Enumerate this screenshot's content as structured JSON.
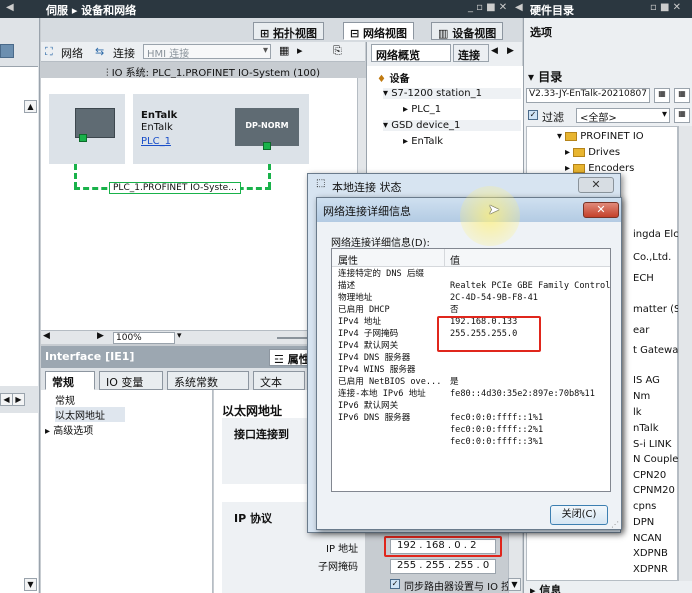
{
  "top_bar": {
    "left_title": "伺服 ▸ 设备和网络",
    "right_title": "硬件目录"
  },
  "view_tabs": {
    "topology": "拓扑视图",
    "network": "网络视图",
    "device": "设备视图"
  },
  "network_toolbar": {
    "network": "网络",
    "connection": "连接",
    "connection_type": "HMI 连接",
    "io_system": "IO 系统: PLC_1.PROFINET IO-System (100)"
  },
  "devices": {
    "plc_name": "EnTalk",
    "plc_type": "EnTalk",
    "plc_link": "PLC_1",
    "dp_norm": "DP-NORM",
    "network_label": "PLC_1.PROFINET IO-Syste..."
  },
  "overview": {
    "tab_overview": "网络概览",
    "tab_connection": "连接",
    "header": "设备",
    "items": [
      "S7-1200 station_1",
      "PLC_1",
      "GSD device_1",
      "EnTalk"
    ]
  },
  "zoom": "100%",
  "catalog": {
    "options_label": "选项",
    "directory_label": "目录",
    "search_value": "V2.33-JY-EnTalk-20210807",
    "filter_label": "过滤",
    "filter_value": "<全部>",
    "tree": [
      "PROFINET IO",
      "Drives",
      "Encoders"
    ],
    "partial_items": [
      "ingda Elc",
      "Co.,Ltd.",
      "ECH",
      "matter (S...",
      "ear",
      "t Gateway",
      "IS AG",
      "Nm",
      "lk",
      "nTalk",
      "S-i LINK",
      "N Coupler",
      "CPN20",
      "CPNM20",
      "cpns",
      "DPN",
      "NCAN",
      "XDPNB",
      "XDPNR"
    ],
    "info_label": "信息"
  },
  "interface": {
    "title": "Interface [IE1]",
    "properties": "属性",
    "tabs": [
      "常规",
      "IO 变量",
      "系统常数",
      "文本"
    ],
    "nav": [
      "常规",
      "以太网地址",
      "高级选项"
    ],
    "section_ethernet": "以太网地址",
    "interface_connected": "接口连接到",
    "ip_protocol": "IP 协议",
    "ip_label": "IP 地址",
    "ip_value": "192 . 168 . 0 . 2",
    "subnet_label": "子网掩码",
    "subnet_value": "255 . 255 . 255 . 0",
    "router_label": "同步路由器设置与 IO 控"
  },
  "dialog_status": {
    "title": "本地连接 状态"
  },
  "dialog_details": {
    "title": "网络连接详细信息",
    "subtitle": "网络连接详细信息(D):",
    "col_property": "属性",
    "col_value": "值",
    "rows": [
      {
        "p": "连接特定的 DNS 后缀",
        "v": ""
      },
      {
        "p": "描述",
        "v": "Realtek PCIe GBE Family Controller"
      },
      {
        "p": "物理地址",
        "v": "2C-4D-54-9B-F8-41"
      },
      {
        "p": "已启用 DHCP",
        "v": "否"
      },
      {
        "p": "IPv4 地址",
        "v": "192.168.0.133"
      },
      {
        "p": "IPv4 子网掩码",
        "v": "255.255.255.0"
      },
      {
        "p": "IPv4 默认网关",
        "v": ""
      },
      {
        "p": "IPv4 DNS 服务器",
        "v": ""
      },
      {
        "p": "IPv4 WINS 服务器",
        "v": ""
      },
      {
        "p": "已启用 NetBIOS ove...",
        "v": "是"
      },
      {
        "p": "连接-本地 IPv6 地址",
        "v": "fe80::4d30:35e2:897e:70b8%11"
      },
      {
        "p": "IPv6 默认网关",
        "v": ""
      },
      {
        "p": "IPv6 DNS 服务器",
        "v": "fec0:0:0:ffff::1%1"
      },
      {
        "p": "",
        "v": "fec0:0:0:ffff::2%1"
      },
      {
        "p": "",
        "v": "fec0:0:0:ffff::3%1"
      }
    ],
    "close_button": "关闭(C)"
  }
}
